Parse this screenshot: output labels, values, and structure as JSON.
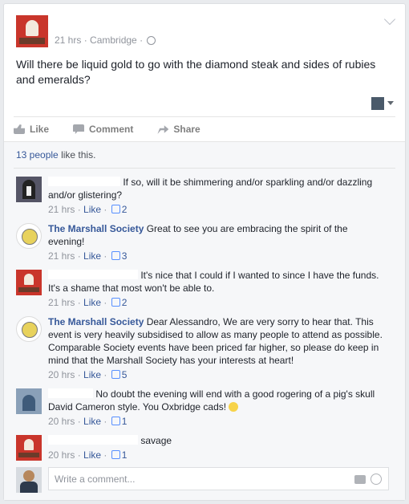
{
  "post": {
    "time": "21 hrs",
    "location": "Cambridge",
    "text": "Will there be liquid gold to go with the diamond steak and sides of rubies and emeralds?"
  },
  "actions": {
    "like": "Like",
    "comment": "Comment",
    "share": "Share"
  },
  "likes_summary": {
    "count_link": "13 people",
    "rest": "like this."
  },
  "comments": [
    {
      "name": "",
      "text": "If so, will it be shimmering and/or sparkling and/or dazzling and/or glistering?",
      "time": "21 hrs",
      "like": "Like",
      "likes": "2"
    },
    {
      "name": "The Marshall Society",
      "text": "Great to see you are embracing the spirit of the evening!",
      "time": "21 hrs",
      "like": "Like",
      "likes": "3"
    },
    {
      "name": "",
      "text": "It's nice that I could if I wanted to since I have the funds. It's a shame that most won't be able to.",
      "time": "21 hrs",
      "like": "Like",
      "likes": "2"
    },
    {
      "name": "The Marshall Society",
      "text": "Dear Alessandro, We are very sorry to hear that. This event is very heavily subsidised to allow as many people to attend as possible. Comparable Society events have been priced far higher, so please do keep in mind that the Marshall Society has your interests at heart!",
      "time": "20 hrs",
      "like": "Like",
      "likes": "5"
    },
    {
      "name": "",
      "text": "No doubt the evening will end with a good rogering of a pig's skull David Cameron style. You Oxbridge cads!",
      "time": "20 hrs",
      "like": "Like",
      "likes": "1"
    },
    {
      "name": "",
      "text": "savage",
      "time": "20 hrs",
      "like": "Like",
      "likes": "1"
    }
  ],
  "composer": {
    "placeholder": "Write a comment..."
  },
  "icons": [
    "chevron-down-icon",
    "globe-icon",
    "like-icon",
    "comment-icon",
    "share-icon",
    "camera-icon",
    "emoji-icon"
  ]
}
